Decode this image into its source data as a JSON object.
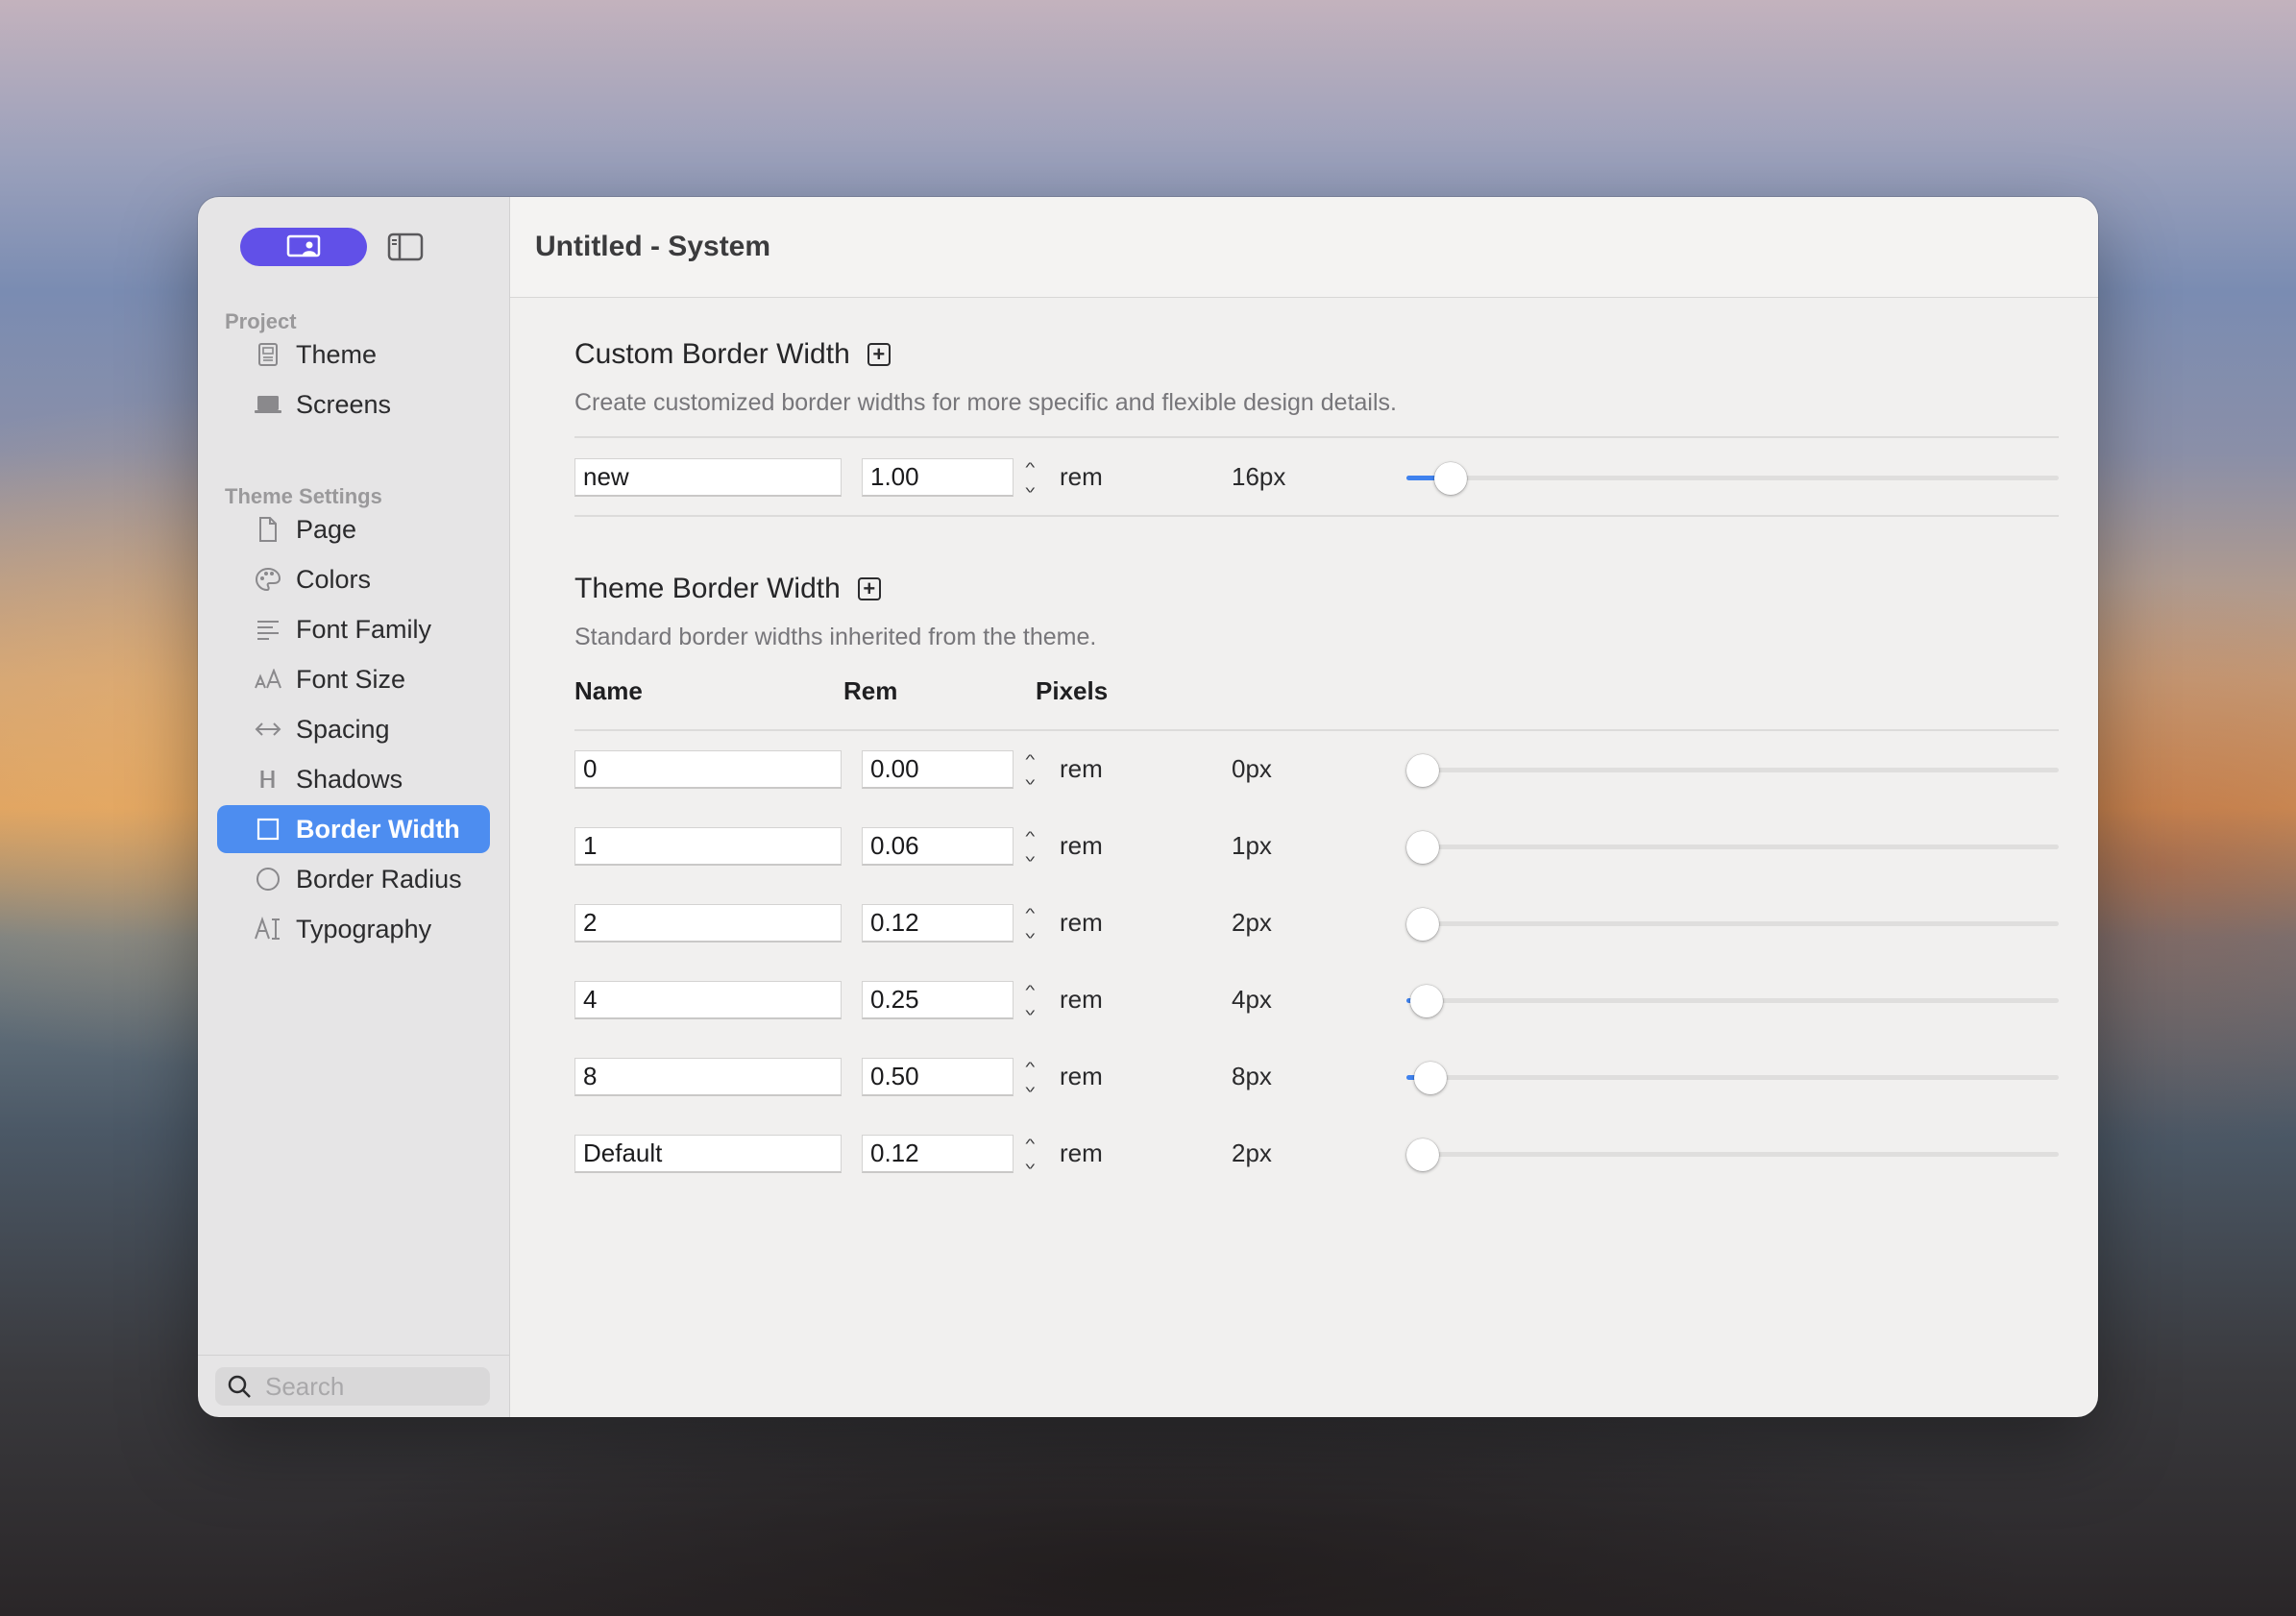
{
  "window": {
    "title": "Untitled - System"
  },
  "sidebar": {
    "project_label": "Project",
    "project_items": [
      {
        "label": "Theme",
        "icon": "theme-doc-icon"
      },
      {
        "label": "Screens",
        "icon": "screens-icon"
      }
    ],
    "settings_label": "Theme Settings",
    "settings_items": [
      {
        "label": "Page",
        "icon": "page-icon"
      },
      {
        "label": "Colors",
        "icon": "palette-icon"
      },
      {
        "label": "Font Family",
        "icon": "font-family-icon"
      },
      {
        "label": "Font Size",
        "icon": "font-size-icon"
      },
      {
        "label": "Spacing",
        "icon": "spacing-icon"
      },
      {
        "label": "Shadows",
        "icon": "shadows-icon"
      },
      {
        "label": "Border Width",
        "icon": "border-width-icon",
        "selected": true
      },
      {
        "label": "Border Radius",
        "icon": "border-radius-icon"
      },
      {
        "label": "Typography",
        "icon": "typography-icon"
      }
    ],
    "search_placeholder": "Search"
  },
  "custom_section": {
    "title": "Custom Border Width",
    "description": "Create customized border widths for more specific and flexible design details.",
    "rows": [
      {
        "name": "new",
        "rem": "1.00",
        "unit": "rem",
        "pixels": "16px",
        "slider_fraction": 0.045
      }
    ]
  },
  "theme_section": {
    "title": "Theme Border Width",
    "description": "Standard border widths inherited from the theme.",
    "columns": {
      "name": "Name",
      "rem": "Rem",
      "pixels": "Pixels"
    },
    "rows": [
      {
        "name": "0",
        "rem": "0.00",
        "unit": "rem",
        "pixels": "0px",
        "slider_fraction": 0.0
      },
      {
        "name": "1",
        "rem": "0.06",
        "unit": "rem",
        "pixels": "1px",
        "slider_fraction": 0.0
      },
      {
        "name": "2",
        "rem": "0.12",
        "unit": "rem",
        "pixels": "2px",
        "slider_fraction": 0.0
      },
      {
        "name": "4",
        "rem": "0.25",
        "unit": "rem",
        "pixels": "4px",
        "slider_fraction": 0.006
      },
      {
        "name": "8",
        "rem": "0.50",
        "unit": "rem",
        "pixels": "8px",
        "slider_fraction": 0.012
      },
      {
        "name": "Default",
        "rem": "0.12",
        "unit": "rem",
        "pixels": "2px",
        "slider_fraction": 0.0
      }
    ]
  },
  "colors": {
    "accent": "#4d8df0",
    "mode_pill": "#6150e8",
    "slider_fill": "#3f82ee"
  }
}
